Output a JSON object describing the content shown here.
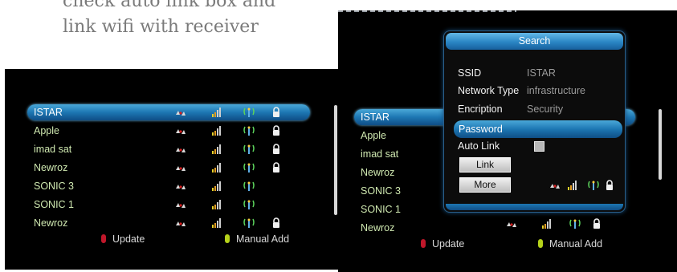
{
  "caption": {
    "line1": "check auto link box and",
    "line2": "link wifi with receiver"
  },
  "colors": {
    "highlight": "#1d77b3",
    "list_text": "#cfe8b0",
    "update_key": "#c0172a",
    "manual_key": "#b6d21a"
  },
  "icons": [
    "signal-icon",
    "strength-bars-icon",
    "antenna-icon",
    "lock-icon"
  ],
  "left_screen": {
    "networks": [
      {
        "name": "ISTAR",
        "selected": true,
        "locked": true
      },
      {
        "name": "Apple",
        "selected": false,
        "locked": true
      },
      {
        "name": "imad sat",
        "selected": false,
        "locked": true
      },
      {
        "name": "Newroz",
        "selected": false,
        "locked": true
      },
      {
        "name": "SONIC 3",
        "selected": false,
        "locked": false
      },
      {
        "name": "SONIC 1",
        "selected": false,
        "locked": false
      },
      {
        "name": "Newroz",
        "selected": false,
        "locked": true
      }
    ],
    "footer": {
      "update": "Update",
      "manual_add": "Manual Add"
    }
  },
  "right_screen": {
    "networks": [
      {
        "name": "ISTAR"
      },
      {
        "name": "Apple"
      },
      {
        "name": "imad sat"
      },
      {
        "name": "Newroz"
      },
      {
        "name": "SONIC 3"
      },
      {
        "name": "SONIC 1"
      },
      {
        "name": "Newroz"
      }
    ],
    "footer": {
      "update": "Update",
      "manual_add": "Manual Add"
    },
    "dialog": {
      "title": "Search",
      "ssid_label": "SSID",
      "ssid_value": "ISTAR",
      "network_type_label": "Network Type",
      "network_type_value": "infrastructure",
      "encription_label": "Encription",
      "encription_value": "Security",
      "password_label": "Password",
      "auto_link_label": "Auto Link",
      "auto_link_checked": false,
      "link_button": "Link",
      "more_button": "More"
    }
  }
}
